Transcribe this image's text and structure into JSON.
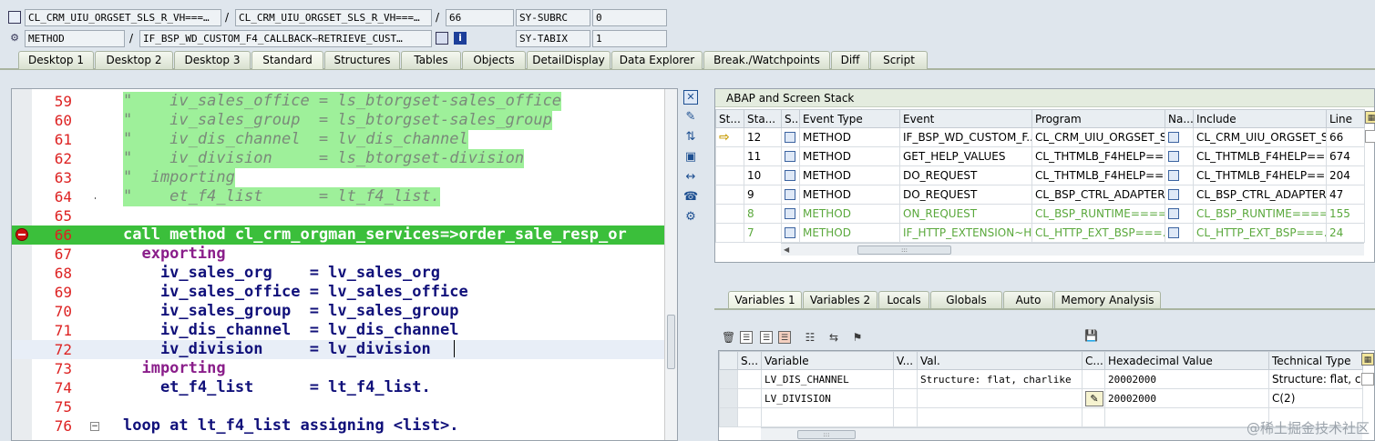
{
  "header": {
    "row1": {
      "class1": "CL_CRM_UIU_ORGSET_SLS_R_VH===…",
      "class2": "CL_CRM_UIU_ORGSET_SLS_R_VH===…",
      "line": "66",
      "sy_label": "SY-SUBRC",
      "sy_value": "0"
    },
    "row2": {
      "type": "METHOD",
      "method": "IF_BSP_WD_CUSTOM_F4_CALLBACK~RETRIEVE_CUST…",
      "sy_label": "SY-TABIX",
      "sy_value": "1"
    },
    "separator": "/"
  },
  "tabs": [
    "Desktop 1",
    "Desktop 2",
    "Desktop 3",
    "Standard",
    "Structures",
    "Tables",
    "Objects",
    "DetailDisplay",
    "Data Explorer",
    "Break./Watchpoints",
    "Diff",
    "Script"
  ],
  "editor": {
    "lines": [
      {
        "num": "59",
        "text": "\"    iv_sales_office = ls_btorgset-sales_office"
      },
      {
        "num": "60",
        "text": "\"    iv_sales_group  = ls_btorgset-sales_group"
      },
      {
        "num": "61",
        "text": "\"    iv_dis_channel  = lv_dis_channel"
      },
      {
        "num": "62",
        "text": "\"    iv_division     = ls_btorgset-division"
      },
      {
        "num": "63",
        "text": "\"  importing"
      },
      {
        "num": "64",
        "text": "\"    et_f4_list      = lt_f4_list."
      },
      {
        "num": "65",
        "text": ""
      },
      {
        "num": "66",
        "text": "call method cl_crm_orgman_services=>order_sale_resp_or"
      },
      {
        "num": "67",
        "text": "  exporting"
      },
      {
        "num": "68",
        "text": "    iv_sales_org    = lv_sales_org"
      },
      {
        "num": "69",
        "text": "    iv_sales_office = lv_sales_office"
      },
      {
        "num": "70",
        "text": "    iv_sales_group  = lv_sales_group"
      },
      {
        "num": "71",
        "text": "    iv_dis_channel  = lv_dis_channel"
      },
      {
        "num": "72",
        "text": "    iv_division     = lv_division"
      },
      {
        "num": "73",
        "text": "  importing"
      },
      {
        "num": "74",
        "text": "    et_f4_list      = lt_f4_list."
      },
      {
        "num": "75",
        "text": ""
      },
      {
        "num": "76",
        "text": "loop at lt_f4_list assigning <list>."
      }
    ]
  },
  "stack": {
    "title": "ABAP and Screen Stack",
    "columns": [
      "St...",
      "Sta...",
      "S...",
      "Event Type",
      "Event",
      "Program",
      "Na...",
      "Include",
      "Line"
    ],
    "rows": [
      {
        "level": "12",
        "etype": "METHOD",
        "event": "IF_BSP_WD_CUSTOM_F...",
        "program": "CL_CRM_UIU_ORGSET_S...",
        "include": "CL_CRM_UIU_ORGSET_S...",
        "line": "66",
        "current": true
      },
      {
        "level": "11",
        "etype": "METHOD",
        "event": "GET_HELP_VALUES",
        "program": "CL_THTMLB_F4HELP==...",
        "include": "CL_THTMLB_F4HELP==...",
        "line": "674"
      },
      {
        "level": "10",
        "etype": "METHOD",
        "event": "DO_REQUEST",
        "program": "CL_THTMLB_F4HELP==...",
        "include": "CL_THTMLB_F4HELP==...",
        "line": "204"
      },
      {
        "level": "9",
        "etype": "METHOD",
        "event": "DO_REQUEST",
        "program": "CL_BSP_CTRL_ADAPTER...",
        "include": "CL_BSP_CTRL_ADAPTER...",
        "line": "47"
      },
      {
        "level": "8",
        "etype": "METHOD",
        "event": "ON_REQUEST",
        "program": "CL_BSP_RUNTIME====...",
        "include": "CL_BSP_RUNTIME====...",
        "line": "155",
        "dim": true
      },
      {
        "level": "7",
        "etype": "METHOD",
        "event": "IF_HTTP_EXTENSION~H...",
        "program": "CL_HTTP_EXT_BSP===...",
        "include": "CL_HTTP_EXT_BSP===...",
        "line": "24",
        "dim": true
      }
    ]
  },
  "var_tabs": [
    "Variables 1",
    "Variables 2",
    "Locals",
    "Globals",
    "Auto",
    "Memory Analysis"
  ],
  "variables": {
    "columns": [
      "S...",
      "Variable",
      "V...",
      "Val.",
      "C...",
      "Hexadecimal Value",
      "Technical Type"
    ],
    "rows": [
      {
        "variable": "LV_DIS_CHANNEL",
        "value": "Structure: flat, charlike",
        "hex": "20002000",
        "type": "Structure: flat, ch"
      },
      {
        "variable": "LV_DIVISION",
        "value": "",
        "hex": "20002000",
        "type": "C(2)",
        "editable": true
      },
      {
        "variable": "",
        "value": "",
        "hex": "",
        "type": ""
      }
    ]
  },
  "watermark": "@稀土掘金技术社区",
  "colors": {
    "current_line": "#3bbf3b",
    "comment_bg": "#9ef09a",
    "line_number": "#dd2222",
    "keyword": "#8a1e8a",
    "variable": "#10107a"
  }
}
